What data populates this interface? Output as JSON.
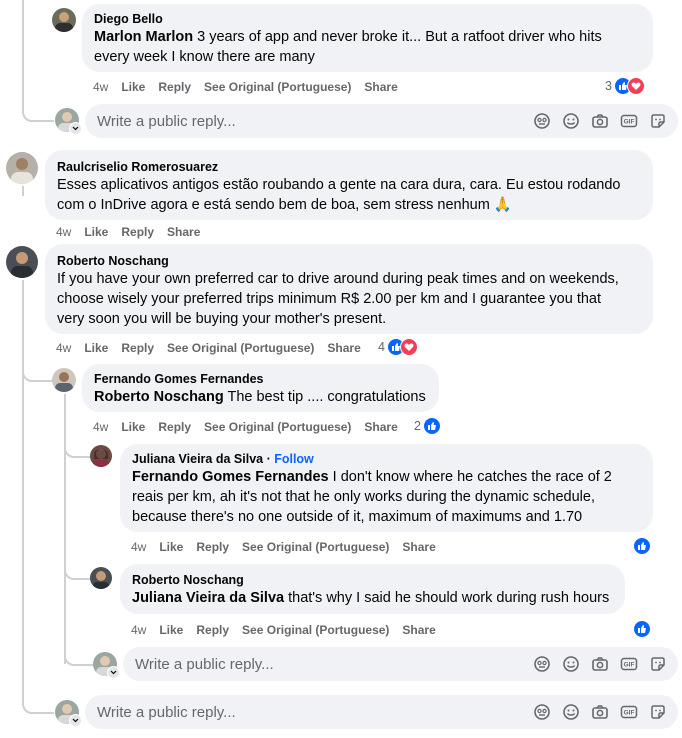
{
  "comments": [
    {
      "author": "Diego Bello",
      "mention": "Marlon Marlon",
      "line1": " 3 years of app and never broke it... But a ratfoot driver who hits",
      "line2": "every week I know there are many",
      "time": "4w",
      "like": "Like",
      "reply": "Reply",
      "see_original": "See Original (Portuguese)",
      "share": "Share",
      "reaction_count": "3"
    },
    {
      "author": "Raulcriselio Romerosuarez",
      "line1": "Esses aplicativos antigos estão roubando a gente na cara dura, cara. Eu estou rodando",
      "line2": "com o InDrive agora e está sendo bem de boa, sem stress nenhum 🙏",
      "time": "4w",
      "like": "Like",
      "reply": "Reply",
      "share": "Share"
    },
    {
      "author": "Roberto Noschang",
      "line1": "If you have your own preferred car to drive around during peak times and on weekends,",
      "line2": "choose wisely your preferred trips minimum R$ 2.00 per km and I guarantee you that",
      "line3": "very soon you will be buying your mother's present.",
      "time": "4w",
      "like": "Like",
      "reply": "Reply",
      "see_original": "See Original (Portuguese)",
      "share": "Share",
      "reaction_count": "4"
    },
    {
      "author": "Fernando Gomes Fernandes",
      "mention": "Roberto Noschang",
      "line1": " The best tip .... congratulations",
      "time": "4w",
      "like": "Like",
      "reply": "Reply",
      "see_original": "See Original (Portuguese)",
      "share": "Share",
      "reaction_count": "2"
    },
    {
      "author": "Juliana Vieira da Silva",
      "follow": "Follow",
      "separator": " · ",
      "mention": "Fernando Gomes Fernandes",
      "line1": " I don't know where he catches the race of 2",
      "line2": "reais per km, ah it's not that he only works during the dynamic schedule,",
      "line3": "because there's no one outside of it, maximum of maximums and 1.70",
      "time": "4w",
      "like": "Like",
      "reply": "Reply",
      "see_original": "See Original (Portuguese)",
      "share": "Share"
    },
    {
      "author": "Roberto Noschang",
      "mention": "Juliana Vieira da Silva",
      "line1": " that's why I said he should work during rush hours",
      "time": "4w",
      "like": "Like",
      "reply": "Reply",
      "see_original": "See Original (Portuguese)",
      "share": "Share"
    }
  ],
  "reply_placeholder": "Write a public reply...",
  "colors": {
    "like": "#0866ff",
    "love": "#f33e58",
    "bubble": "#f0f2f5",
    "meta": "#65676b"
  },
  "icons": [
    "avatar-sticker-icon",
    "emoji-icon",
    "camera-icon",
    "gif-icon",
    "sticker-icon"
  ]
}
